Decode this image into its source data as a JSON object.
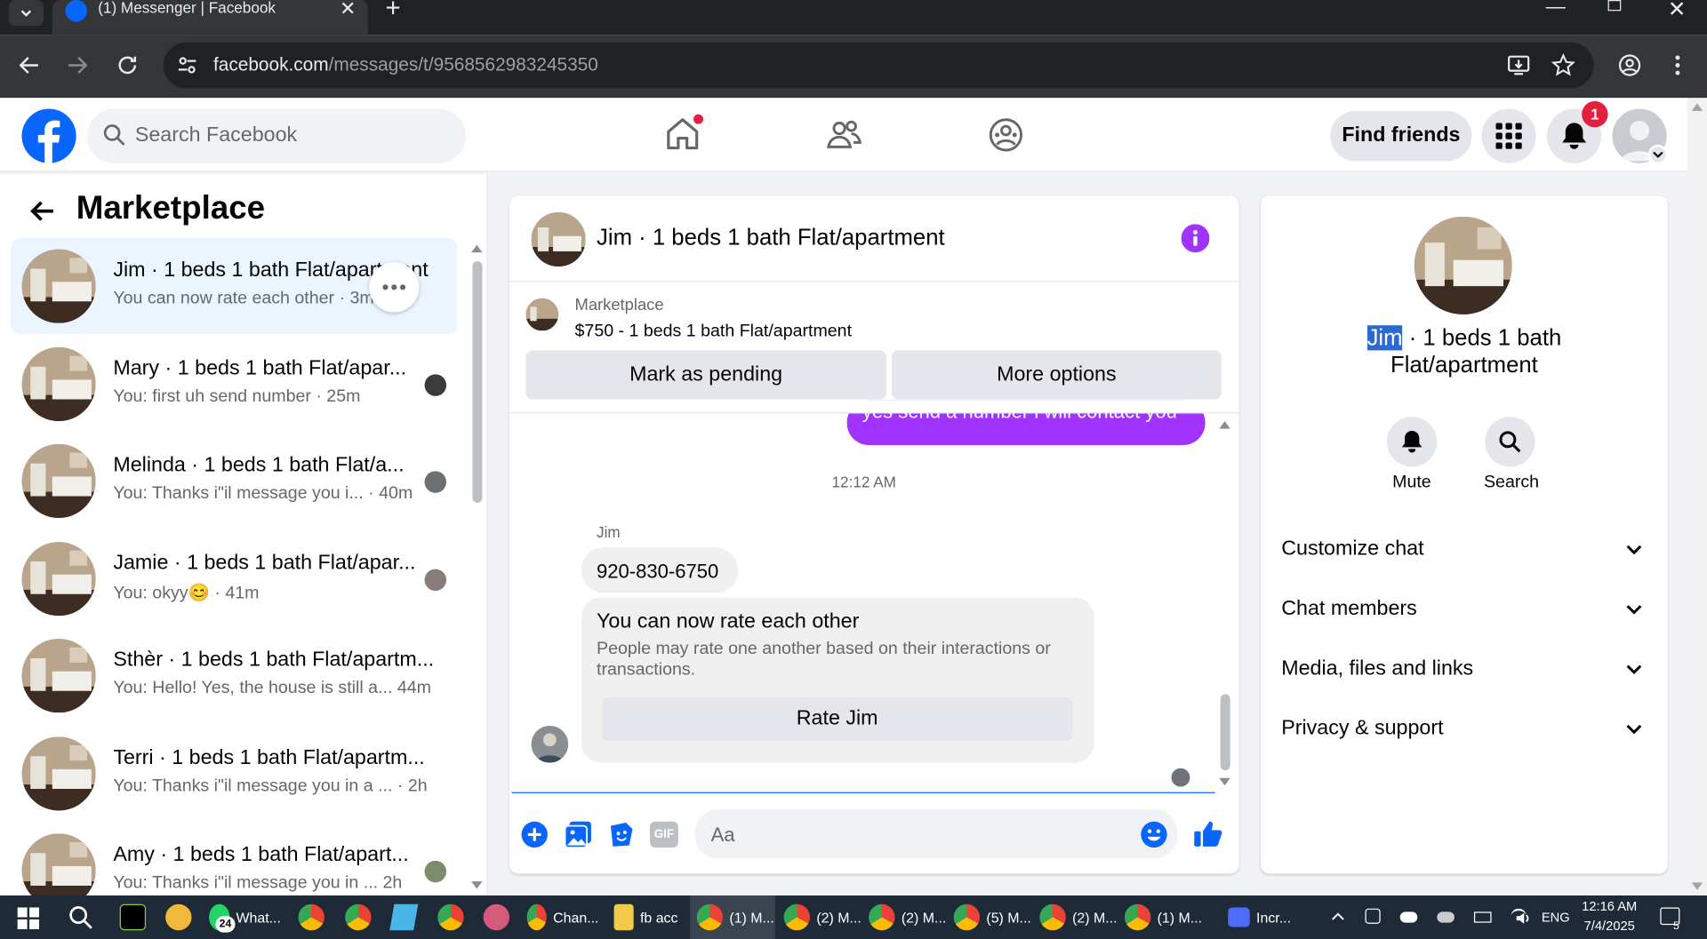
{
  "browser": {
    "tab_title": "(1) Messenger | Facebook",
    "url_domain": "facebook.com",
    "url_path": "/messages/t/9568562983245350"
  },
  "header": {
    "search_placeholder": "Search Facebook",
    "find_friends": "Find friends",
    "notification_count": "1"
  },
  "left": {
    "title": "Marketplace",
    "conversations": [
      {
        "name": "Jim · 1 beds 1 bath Flat/apartment",
        "preview": "You can now rate each other · 3m"
      },
      {
        "name": "Mary · 1 beds 1 bath Flat/apar...",
        "preview": "You: first uh send number · 25m"
      },
      {
        "name": "Melinda · 1 beds 1 bath Flat/a...",
        "preview": "You: Thanks i\"il message you i...  · 40m"
      },
      {
        "name": "Jamie · 1 beds 1 bath Flat/apar...",
        "preview": "You: okyy😊 · 41m"
      },
      {
        "name": "Sthèr · 1 beds 1 bath Flat/apartm...",
        "preview": "You: Hello! Yes, the house is still a...  44m"
      },
      {
        "name": "Terri · 1 beds 1 bath Flat/apartm...",
        "preview": "You: Thanks i\"il message you in a ...   · 2h"
      },
      {
        "name": "Amy · 1 beds 1 bath Flat/apart...",
        "preview": "You: Thanks i\"il message you in ...  2h"
      }
    ]
  },
  "chat": {
    "title": "Jim · 1 beds 1 bath Flat/apartment",
    "listing_source": "Marketplace",
    "listing_title": "$750 - 1 beds 1 bath Flat/apartment",
    "mark_pending": "Mark as pending",
    "more_options": "More options",
    "sent_message": "yes send a number i will contact you",
    "timestamp": "12:12 AM",
    "sender_name": "Jim",
    "received_message": "920-830-6750",
    "rate_title": "You can now rate each other",
    "rate_desc": "People may rate one another based on their interactions or transactions.",
    "rate_button": "Rate Jim",
    "composer_placeholder": "Aa"
  },
  "info": {
    "name_highlight": "Jim",
    "name_rest": " · 1 beds 1 bath",
    "name_line2": "Flat/apartment",
    "mute": "Mute",
    "search": "Search",
    "sections": [
      "Customize chat",
      "Chat members",
      "Media, files and links",
      "Privacy & support"
    ]
  },
  "taskbar": {
    "whatsapp_badge": "24",
    "apps": [
      "What...",
      "Chan...",
      "fb acc",
      "(1) M...",
      "(2) M...",
      "(2) M...",
      "(5) M...",
      "(2) M...",
      "(1) M...",
      "Incr..."
    ],
    "lang": "ENG",
    "time": "12:16 AM",
    "date": "7/4/2025",
    "notif": "5"
  },
  "colors": {
    "fb_blue": "#0866ff",
    "messenger_purple": "#a033ff",
    "taskbar": "#1f2a38"
  }
}
